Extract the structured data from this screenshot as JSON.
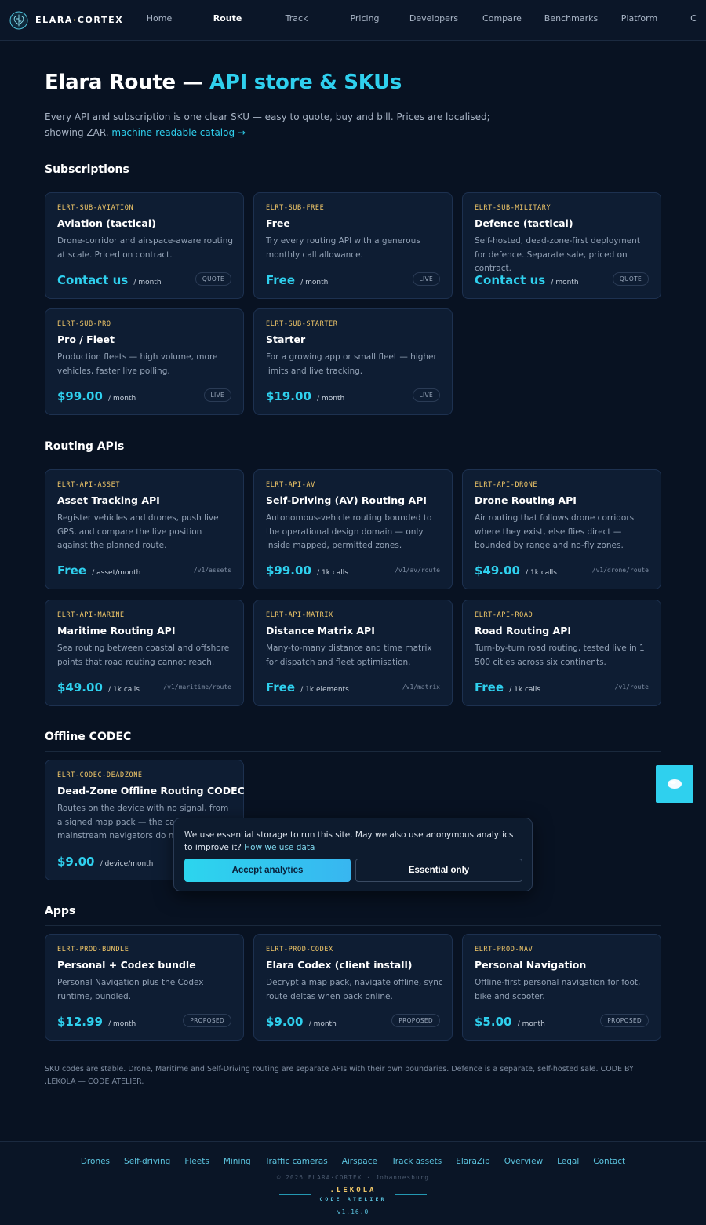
{
  "nav": {
    "brand_main": "ELARA",
    "brand_dot": "·",
    "brand_rest": "CORTEX",
    "items": [
      "Home",
      "Route",
      "Track",
      "Pricing",
      "Developers",
      "Compare",
      "Benchmarks",
      "Platform",
      "C"
    ],
    "active": "Route"
  },
  "header": {
    "title_main": "Elara Route — ",
    "title_accent": "API store & SKUs",
    "intro": "Every API and subscription is one clear SKU — easy to quote, buy and bill. Prices are localised; showing ZAR.",
    "catalog_link": "machine-readable catalog →"
  },
  "sections": {
    "subscriptions": "Subscriptions",
    "routing": "Routing APIs",
    "codec": "Offline CODEC",
    "apps": "Apps"
  },
  "subscriptions": [
    {
      "sku": "ELRT-SUB-AVIATION",
      "name": "Aviation (tactical)",
      "desc": "Drone-corridor and airspace-aware routing at scale. Priced on contract.",
      "price": "Contact us",
      "unit": "/ month",
      "badge": "QUOTE"
    },
    {
      "sku": "ELRT-SUB-FREE",
      "name": "Free",
      "desc": "Try every routing API with a generous monthly call allowance.",
      "price": "Free",
      "unit": "/ month",
      "badge": "LIVE"
    },
    {
      "sku": "ELRT-SUB-MILITARY",
      "name": "Defence (tactical)",
      "desc": "Self-hosted, dead-zone-first deployment for defence. Separate sale, priced on contract.",
      "price": "Contact us",
      "unit": "/ month",
      "badge": "QUOTE"
    },
    {
      "sku": "ELRT-SUB-PRO",
      "name": "Pro / Fleet",
      "desc": "Production fleets — high volume, more vehicles, faster live polling.",
      "price": "$99.00",
      "unit": "/ month",
      "badge": "LIVE"
    },
    {
      "sku": "ELRT-SUB-STARTER",
      "name": "Starter",
      "desc": "For a growing app or small fleet — higher limits and live tracking.",
      "price": "$19.00",
      "unit": "/ month",
      "badge": "LIVE"
    }
  ],
  "routing_apis": [
    {
      "sku": "ELRT-API-ASSET",
      "name": "Asset Tracking API",
      "desc": "Register vehicles and drones, push live GPS, and compare the live position against the planned route.",
      "price": "Free",
      "unit": "/ asset/month",
      "endpoint": "/v1/assets"
    },
    {
      "sku": "ELRT-API-AV",
      "name": "Self-Driving (AV) Routing API",
      "desc": "Autonomous-vehicle routing bounded to the operational design domain — only inside mapped, permitted zones.",
      "price": "$99.00",
      "unit": "/ 1k calls",
      "endpoint": "/v1/av/route"
    },
    {
      "sku": "ELRT-API-DRONE",
      "name": "Drone Routing API",
      "desc": "Air routing that follows drone corridors where they exist, else flies direct — bounded by range and no-fly zones.",
      "price": "$49.00",
      "unit": "/ 1k calls",
      "endpoint": "/v1/drone/route"
    },
    {
      "sku": "ELRT-API-MARINE",
      "name": "Maritime Routing API",
      "desc": "Sea routing between coastal and offshore points that road routing cannot reach.",
      "price": "$49.00",
      "unit": "/ 1k calls",
      "endpoint": "/v1/maritime/route"
    },
    {
      "sku": "ELRT-API-MATRIX",
      "name": "Distance Matrix API",
      "desc": "Many-to-many distance and time matrix for dispatch and fleet optimisation.",
      "price": "Free",
      "unit": "/ 1k elements",
      "endpoint": "/v1/matrix"
    },
    {
      "sku": "ELRT-API-ROAD",
      "name": "Road Routing API",
      "desc": "Turn-by-turn road routing, tested live in 1 500 cities across six continents.",
      "price": "Free",
      "unit": "/ 1k calls",
      "endpoint": "/v1/route"
    }
  ],
  "codec": [
    {
      "sku": "ELRT-CODEC-DEADZONE",
      "name": "Dead-Zone Offline Routing CODEC",
      "desc": "Routes on the device with no signal, from a signed map pack — the capabil",
      "desc_line3": "mainstream navigators do not",
      "price": "$9.00",
      "unit": "/ device/month"
    }
  ],
  "apps": [
    {
      "sku": "ELRT-PROD-BUNDLE",
      "name": "Personal + Codex bundle",
      "desc": "Personal Navigation plus the Codex runtime, bundled.",
      "price": "$12.99",
      "unit": "/ month",
      "badge": "PROPOSED"
    },
    {
      "sku": "ELRT-PROD-CODEX",
      "name": "Elara Codex (client install)",
      "desc": "Decrypt a map pack, navigate offline, sync route deltas when back online.",
      "price": "$9.00",
      "unit": "/ month",
      "badge": "PROPOSED"
    },
    {
      "sku": "ELRT-PROD-NAV",
      "name": "Personal Navigation",
      "desc": "Offline-first personal navigation for foot, bike and scooter.",
      "price": "$5.00",
      "unit": "/ month",
      "badge": "PROPOSED"
    }
  ],
  "footnote": "SKU codes are stable. Drone, Maritime and Self-Driving routing are separate APIs with their own boundaries. Defence is a separate, self-hosted sale. CODE BY .LEKOLA — CODE ATELIER.",
  "cookie": {
    "text": "We use essential storage to run this site. May we also use anonymous analytics to improve it?",
    "link": "How we use data",
    "accept": "Accept analytics",
    "essential": "Essential only"
  },
  "footer": {
    "links": [
      "Drones",
      "Self-driving",
      "Fleets",
      "Mining",
      "Traffic cameras",
      "Airspace",
      "Track assets",
      "ElaraZip",
      "Overview",
      "Legal",
      "Contact"
    ],
    "copyright": "© 2026 ELARA·CORTEX · Johannesburg",
    "lekola": ".LEKOLA",
    "atelier": "CODE ATELIER",
    "version": "v1.16.0"
  },
  "colors": {
    "background": "#081222",
    "card": "#0e1d33",
    "accent": "#2fd0ee",
    "sku_gold": "#f3c969"
  }
}
